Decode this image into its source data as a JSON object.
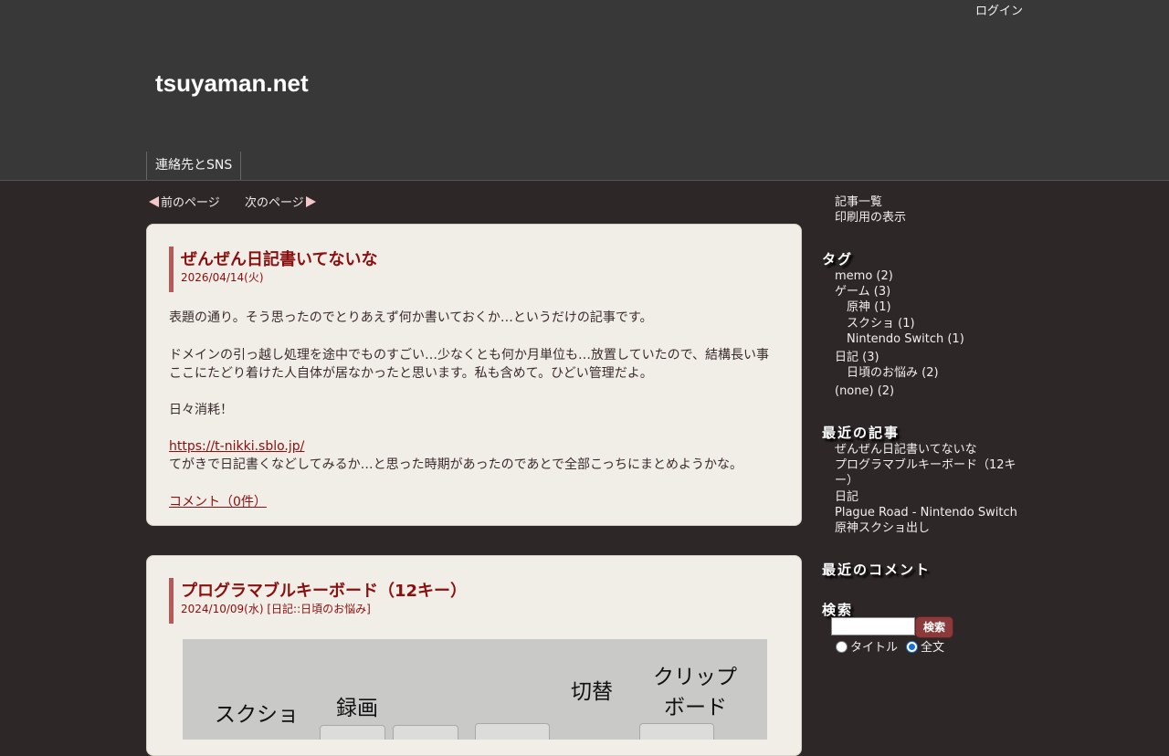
{
  "header": {
    "login": "ログイン",
    "site_title": "tsuyaman.net",
    "nav": [
      "連絡先とSNS"
    ]
  },
  "pager": {
    "prev": "前のページ",
    "next": "次のページ"
  },
  "articles": [
    {
      "title": "ぜんぜん日記書いてないな",
      "date": "2026/04/14(火)",
      "paragraphs": [
        "表題の通り。そう思ったのでとりあえず何か書いておくか…というだけの記事です。",
        "ドメインの引っ越し処理を途中でものすごい…少なくとも何か月単位も…放置していたので、結構長い事",
        "ここにたどり着けた人自体が居なかったと思います。私も含めて。ひどい管理だよ。",
        "日々消耗！"
      ],
      "link": "https://t-nikki.sblo.jp/",
      "link_note": "てがきで日記書くなどしてみるか…と思った時期があったのであとで全部こっちにまとめようかな。",
      "comments": "コメント（0件）"
    },
    {
      "title": "プログラマブルキーボード（12キー）",
      "date": "2024/10/09(水) [日記::日頃のお悩み]",
      "photo_labels": [
        "スクショ",
        "録画",
        "切替",
        "クリップ",
        "ボード"
      ]
    }
  ],
  "sidebar": {
    "links": [
      "記事一覧",
      "印刷用の表示"
    ],
    "tags_heading": "タグ",
    "tags": [
      {
        "label": "memo (2)"
      },
      {
        "label": "ゲーム (3)"
      },
      {
        "label": "原神 (1)"
      },
      {
        "label": "スクショ (1)"
      },
      {
        "label": "Nintendo Switch (1)"
      },
      {
        "label": "日記 (3)"
      },
      {
        "label": "日頃のお悩み (2)"
      },
      {
        "label": "(none) (2)"
      }
    ],
    "recent_posts_heading": "最近の記事",
    "recent_posts": [
      "ぜんぜん日記書いてないな",
      "プログラマブルキーボード（12キ",
      "ー）",
      "日記",
      "Plague Road - Nintendo Switch",
      "原神スクショ出し"
    ],
    "recent_comments_heading": "最近のコメント",
    "search_heading": "検索",
    "search_button": "検索",
    "search_value": "",
    "radio_title": "タイトル",
    "radio_fulltext": "全文"
  }
}
